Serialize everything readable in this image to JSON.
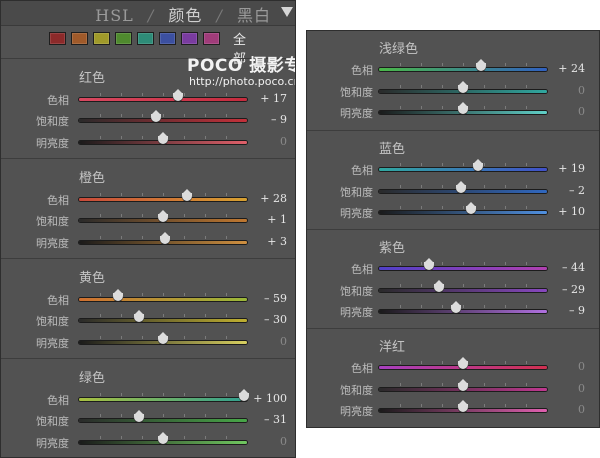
{
  "header": {
    "tabs": [
      "HSL",
      "颜色",
      "黑白"
    ],
    "separator": "/",
    "active_tab": "颜色"
  },
  "swatches": [
    "#8c2a2a",
    "#a05a2a",
    "#a09a2a",
    "#4f8a2e",
    "#2e8c78",
    "#3c50a0",
    "#7a3ca0",
    "#a03c7a"
  ],
  "all_label": "全部",
  "watermark": {
    "brand": "POCO 摄影专题",
    "url": "http://photo.poco.cn/"
  },
  "row_labels": [
    "色相",
    "饱和度",
    "明亮度"
  ],
  "left_sections": [
    {
      "name": "红色",
      "rows": [
        {
          "value": "+ 17",
          "pos": 0.59,
          "track": [
            "#d84860",
            "#c52b3d"
          ],
          "active": true
        },
        {
          "value": "– 9",
          "pos": 0.46,
          "track": [
            "#2a2a2a",
            "#c4303a"
          ],
          "active": true
        },
        {
          "value": "0",
          "pos": 0.5,
          "track": [
            "#1a1a1a",
            "#e0606a"
          ],
          "active": false
        }
      ]
    },
    {
      "name": "橙色",
      "rows": [
        {
          "value": "+ 28",
          "pos": 0.64,
          "track": [
            "#c94a3a",
            "#d6a030"
          ],
          "active": true
        },
        {
          "value": "+ 1",
          "pos": 0.5,
          "track": [
            "#2a2a2a",
            "#c07830"
          ],
          "active": true
        },
        {
          "value": "+ 3",
          "pos": 0.51,
          "track": [
            "#1a1a1a",
            "#d09040"
          ],
          "active": true
        }
      ]
    },
    {
      "name": "黄色",
      "rows": [
        {
          "value": "– 59",
          "pos": 0.23,
          "track": [
            "#d07030",
            "#9ab838"
          ],
          "active": true
        },
        {
          "value": "– 30",
          "pos": 0.36,
          "track": [
            "#2a2a2a",
            "#c0b030"
          ],
          "active": true
        },
        {
          "value": "0",
          "pos": 0.5,
          "track": [
            "#1a1a1a",
            "#d8d060"
          ],
          "active": false
        }
      ]
    },
    {
      "name": "绿色",
      "rows": [
        {
          "value": "+ 100",
          "pos": 0.98,
          "track": [
            "#a8c040",
            "#30a090"
          ],
          "active": true
        },
        {
          "value": "– 31",
          "pos": 0.36,
          "track": [
            "#2a2a2a",
            "#48a848"
          ],
          "active": true
        },
        {
          "value": "0",
          "pos": 0.5,
          "track": [
            "#1a1a1a",
            "#70c860"
          ],
          "active": false
        }
      ]
    }
  ],
  "right_sections": [
    {
      "name": "浅绿色",
      "rows": [
        {
          "value": "+ 24",
          "pos": 0.61,
          "track": [
            "#4ab848",
            "#3060c0"
          ],
          "active": true
        },
        {
          "value": "0",
          "pos": 0.5,
          "track": [
            "#2a2a2a",
            "#30a8a0"
          ],
          "active": false
        },
        {
          "value": "0",
          "pos": 0.5,
          "track": [
            "#1a1a1a",
            "#60d0c8"
          ],
          "active": false
        }
      ]
    },
    {
      "name": "蓝色",
      "rows": [
        {
          "value": "+ 19",
          "pos": 0.59,
          "track": [
            "#30a8a0",
            "#4050c8"
          ],
          "active": true
        },
        {
          "value": "– 2",
          "pos": 0.49,
          "track": [
            "#2a2a2a",
            "#3068c0"
          ],
          "active": true
        },
        {
          "value": "+ 10",
          "pos": 0.55,
          "track": [
            "#1a1a1a",
            "#5090e0"
          ],
          "active": true
        }
      ]
    },
    {
      "name": "紫色",
      "rows": [
        {
          "value": "– 44",
          "pos": 0.3,
          "track": [
            "#5040c8",
            "#b040b0"
          ],
          "active": true
        },
        {
          "value": "– 29",
          "pos": 0.36,
          "track": [
            "#2a2a2a",
            "#8848c0"
          ],
          "active": true
        },
        {
          "value": "– 9",
          "pos": 0.46,
          "track": [
            "#1a1a1a",
            "#b070e0"
          ],
          "active": true
        }
      ]
    },
    {
      "name": "洋红",
      "rows": [
        {
          "value": "0",
          "pos": 0.5,
          "track": [
            "#a840c0",
            "#d03050"
          ],
          "active": false
        },
        {
          "value": "0",
          "pos": 0.5,
          "track": [
            "#2a2a2a",
            "#c03890"
          ],
          "active": false
        },
        {
          "value": "0",
          "pos": 0.5,
          "track": [
            "#1a1a1a",
            "#e060b0"
          ],
          "active": false
        }
      ]
    }
  ],
  "colors": {
    "panel_bg": "#525252",
    "value_active": "#e6e6e6",
    "value_zero": "#8a8a8a"
  }
}
